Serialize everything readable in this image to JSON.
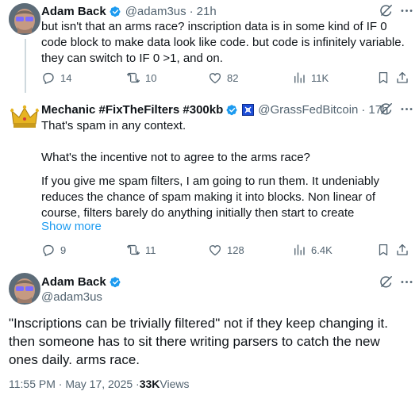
{
  "tweets": [
    {
      "author_name": "Adam Back",
      "handle": "@adam3us",
      "time": "21h",
      "text": "but isn't that an arms race? inscription data is in some kind of IF 0 code block to make data look like code. but code is infinitely variable. they can switch to IF 0 >1, and on.",
      "replies": "14",
      "reposts": "10",
      "likes": "82",
      "views": "11K"
    },
    {
      "author_name": "Mechanic #FixTheFilters #300kb",
      "handle": "@GrassFedBitcoin",
      "time": "17h",
      "text_p1": "That's spam in any context.",
      "text_p2": "What's the incentive not to agree to the arms race?",
      "text_p3": "If you give me spam filters, I am going to run them. It undeniably reduces the chance of spam making it into blocks. Non linear of course, filters barely do anything initially then start to create",
      "show_more": "Show more",
      "replies": "9",
      "reposts": "11",
      "likes": "128",
      "views": "6.4K"
    }
  ],
  "main_tweet": {
    "author_name": "Adam Back",
    "handle": "@adam3us",
    "text": "\"Inscriptions can be trivially filtered\" not if they keep changing it. then someone has to sit there writing parsers to catch the new ones daily. arms race.",
    "timestamp": "11:55 PM · May 17, 2025 · ",
    "views_count": "33K",
    "views_label": " Views"
  },
  "colors": {
    "verified": "#1d9bf0",
    "link": "#1d9bf0",
    "text": "#0f1419",
    "muted": "#536471",
    "affiliate_badge": "#1d4ed8",
    "crown": "#e6b422"
  },
  "icons": [
    "verified-badge-icon",
    "grok-icon",
    "more-icon",
    "reply-icon",
    "repost-icon",
    "like-icon",
    "views-icon",
    "bookmark-icon",
    "share-icon",
    "crown-avatar-icon",
    "affiliate-badge-icon"
  ]
}
